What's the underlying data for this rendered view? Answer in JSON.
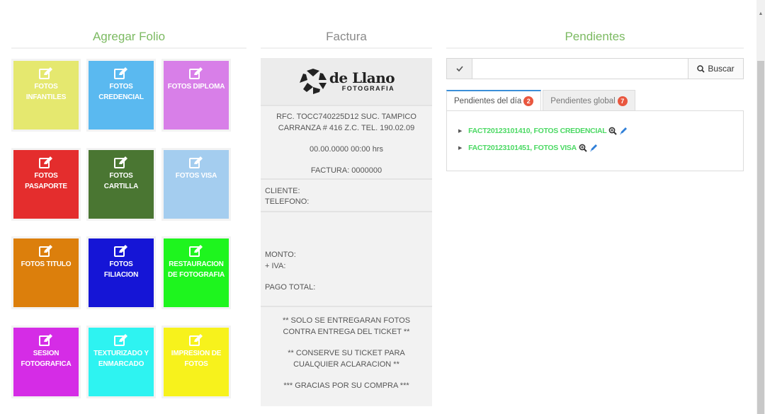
{
  "left": {
    "title": "Agregar Folio",
    "tiles": [
      {
        "label": "FOTOS INFANTILES",
        "bg": "#e5e86f",
        "fg": "#ffffff"
      },
      {
        "label": "FOTOS CREDENCIAL",
        "bg": "#5ab9f0",
        "fg": "#ffffff"
      },
      {
        "label": "FOTOS DIPLOMA",
        "bg": "#d87fe8",
        "fg": "#ffffff"
      },
      {
        "label": "FOTOS PASAPORTE",
        "bg": "#e42d2d",
        "fg": "#ffffff"
      },
      {
        "label": "FOTOS CARTILLA",
        "bg": "#4a7632",
        "fg": "#ffffff"
      },
      {
        "label": "FOTOS VISA",
        "bg": "#a4cdef",
        "fg": "#ffffff"
      },
      {
        "label": "FOTOS TITULO",
        "bg": "#dc7f0c",
        "fg": "#ffffff"
      },
      {
        "label": "FOTOS FILIACION",
        "bg": "#1515d6",
        "fg": "#ffffff"
      },
      {
        "label": "RESTAURACION DE FOTOGRAFIA",
        "bg": "#1ef51e",
        "fg": "#ffffff"
      },
      {
        "label": "SESION FOTOGRAFICA",
        "bg": "#d52ce6",
        "fg": "#ffffff"
      },
      {
        "label": "TEXTURIZADO Y ENMARCADO",
        "bg": "#2ef3f1",
        "fg": "#ffffff"
      },
      {
        "label": "IMPRESION DE FOTOS",
        "bg": "#f7f21c",
        "fg": "#ffffff"
      }
    ]
  },
  "middle": {
    "title": "Factura",
    "logo": {
      "brand": "de Llano",
      "sub": "FOTOGRAFIA"
    },
    "rfc_line1": "RFC. TOCC740225D12 SUC. TAMPICO",
    "rfc_line2": "CARRANZA # 416 Z.C. TEL. 190.02.09",
    "datetime": "00.00.0000 00:00 hrs",
    "factura": "FACTURA: 0000000",
    "cliente": "CLIENTE:",
    "telefono": "TELEFONO:",
    "monto": "MONTO:",
    "iva": "+ IVA:",
    "pago_total": "PAGO TOTAL:",
    "notice1": "** SOLO SE ENTREGARAN FOTOS CONTRA ENTREGA DEL TICKET **",
    "notice2": "** CONSERVE SU TICKET PARA CUALQUIER ACLARACION **",
    "notice3": "*** GRACIAS POR SU COMPRA ***"
  },
  "right": {
    "title": "Pendientes",
    "search": {
      "placeholder": "",
      "button_label": "Buscar"
    },
    "tabs": [
      {
        "label": "Pendientes del día",
        "badge": "2"
      },
      {
        "label": "Pendientes global",
        "badge": "7"
      }
    ],
    "items": [
      {
        "label": "FACT20123101410, FOTOS CREDENCIAL"
      },
      {
        "label": "FACT20123101451, FOTOS VISA"
      }
    ]
  },
  "colors": {
    "accent_green": "#7cba62",
    "link_green": "#4cd964",
    "badge_red": "#e9573f",
    "tab_blue": "#3b8fd8"
  }
}
